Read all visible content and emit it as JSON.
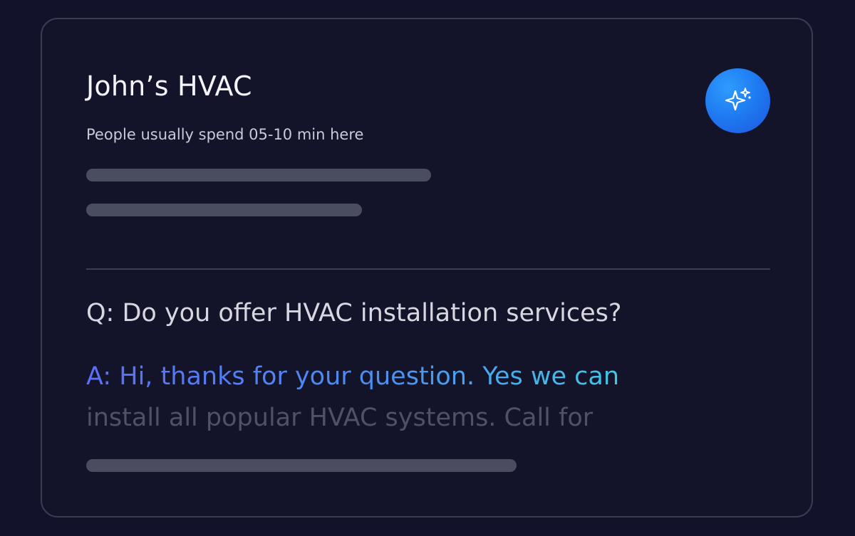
{
  "business": {
    "name": "John’s HVAC",
    "visit_note": "People usually spend 05-10 min here"
  },
  "ai_button": {
    "icon": "sparkle-icon",
    "color": "#1f7cf2"
  },
  "qa": {
    "question": "Q: Do you offer HVAC installation services?",
    "answer_line_1": "A: Hi, thanks for your question. Yes we can",
    "answer_line_2": "install all popular HVAC systems. Call for"
  },
  "colors": {
    "background": "#12132a",
    "answer_gradient_start": "#5a6ff8",
    "answer_gradient_end": "#45c6e6"
  }
}
